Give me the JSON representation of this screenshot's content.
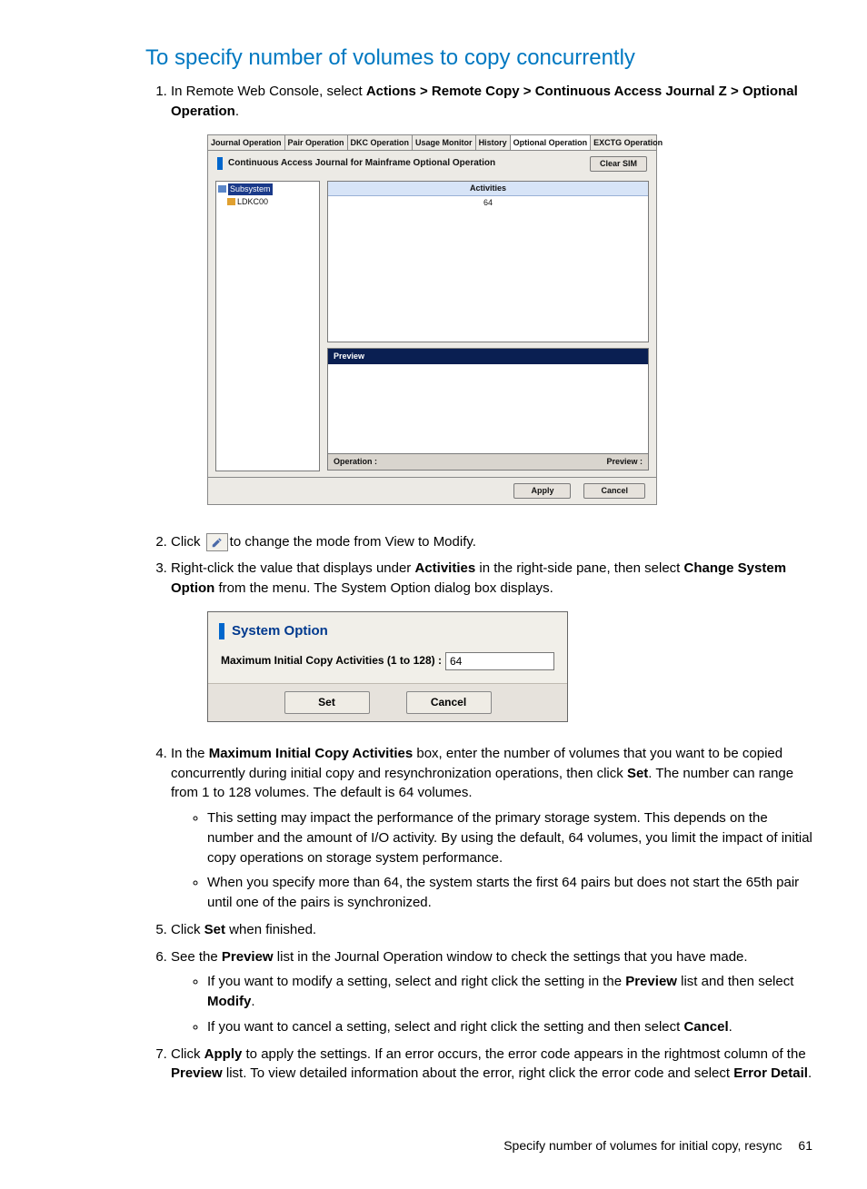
{
  "heading": "To specify number of volumes to copy concurrently",
  "steps": {
    "s1_pre": "In Remote Web Console, select ",
    "s1_path": "Actions > Remote Copy > Continuous Access Journal Z > Optional Operation",
    "s1_post": ".",
    "s2_pre": "Click ",
    "s2_post": "to change the mode from View to Modify.",
    "s3_a": "Right-click the value that displays under ",
    "s3_b": "Activities",
    "s3_c": " in the right-side pane, then select ",
    "s3_d": "Change System Option",
    "s3_e": " from the menu. The System Option dialog box displays.",
    "s4_a": "In the ",
    "s4_b": "Maximum Initial Copy Activities",
    "s4_c": " box, enter the number of volumes that you want to be copied concurrently during initial copy and resynchronization operations, then click ",
    "s4_d": "Set",
    "s4_e": ". The number can range from 1 to 128 volumes. The default is 64 volumes.",
    "s4_bullets": [
      "This setting may impact the performance of the primary storage system. This depends on the number and the amount of I/O activity. By using the default, 64 volumes, you limit the impact of initial copy operations on storage system performance.",
      "When you specify more than 64, the system starts the first 64 pairs but does not start the 65th pair until one of the pairs is synchronized."
    ],
    "s5_a": "Click ",
    "s5_b": "Set",
    "s5_c": " when finished.",
    "s6_a": "See the ",
    "s6_b": "Preview",
    "s6_c": " list in the Journal Operation window to check the settings that you have made.",
    "s6_b1_a": "If you want to modify a setting, select and right click the setting in the ",
    "s6_b1_b": "Preview",
    "s6_b1_c": " list and then select ",
    "s6_b1_d": "Modify",
    "s6_b1_e": ".",
    "s6_b2_a": "If you want to cancel a setting, select and right click the setting and then select ",
    "s6_b2_b": "Cancel",
    "s6_b2_c": ".",
    "s7_a": "Click ",
    "s7_b": "Apply",
    "s7_c": " to apply the settings. If an error occurs, the error code appears in the rightmost column of the ",
    "s7_d": "Preview",
    "s7_e": " list. To view detailed information about the error, right click the error code and select ",
    "s7_f": "Error Detail",
    "s7_g": "."
  },
  "opop": {
    "tabs": [
      "Journal Operation",
      "Pair Operation",
      "DKC Operation",
      "Usage Monitor",
      "History",
      "Optional Operation",
      "EXCTG Operation"
    ],
    "active_tab": "Optional Operation",
    "title": "Continuous Access Journal for Mainframe Optional Operation",
    "clear_sim": "Clear SIM",
    "tree_root": "Subsystem",
    "tree_child": "LDKC00",
    "col_activities": "Activities",
    "val_activities": "64",
    "preview_label": "Preview",
    "operation_label": "Operation :",
    "preview_status_label": "Preview :",
    "apply": "Apply",
    "cancel": "Cancel"
  },
  "sysopt": {
    "title": "System Option",
    "field_label": "Maximum Initial Copy Activities (1 to 128) :",
    "field_value": "64",
    "set": "Set",
    "cancel": "Cancel"
  },
  "footer": {
    "text": "Specify number of volumes for initial copy, resync",
    "page": "61"
  }
}
